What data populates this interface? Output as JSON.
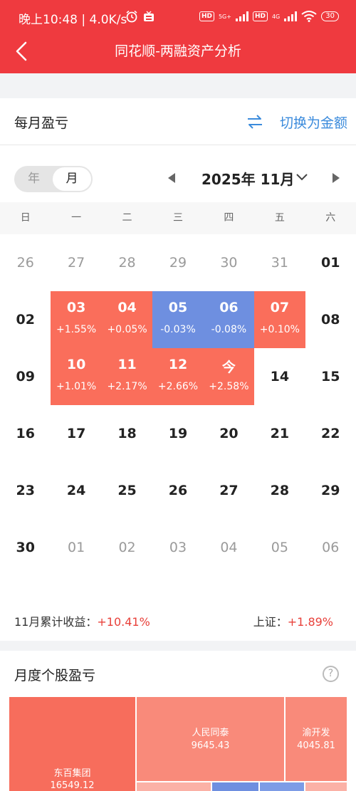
{
  "status": {
    "time": "晚上10:48 | 4.0K/s",
    "hd": "HD",
    "net1": "5G+",
    "net2": "4G",
    "battery": "30"
  },
  "header": {
    "title": "同花顺-两融资产分析"
  },
  "monthly": {
    "title": "每月盈亏",
    "switch_label": "切换为金额"
  },
  "toggle": {
    "year": "年",
    "month": "月"
  },
  "calendar": {
    "month_label": "2025年 11月",
    "weekdays": [
      "日",
      "一",
      "二",
      "三",
      "四",
      "五",
      "六"
    ],
    "weeks": [
      [
        {
          "d": "26",
          "muted": true
        },
        {
          "d": "27",
          "muted": true
        },
        {
          "d": "28",
          "muted": true
        },
        {
          "d": "29",
          "muted": true
        },
        {
          "d": "30",
          "muted": true
        },
        {
          "d": "31",
          "muted": true
        },
        {
          "d": "01"
        }
      ],
      [
        {
          "d": "02"
        },
        {
          "d": "03",
          "pct": "+1.55%",
          "dir": "up"
        },
        {
          "d": "04",
          "pct": "+0.05%",
          "dir": "up"
        },
        {
          "d": "05",
          "pct": "-0.03%",
          "dir": "down"
        },
        {
          "d": "06",
          "pct": "-0.08%",
          "dir": "down"
        },
        {
          "d": "07",
          "pct": "+0.10%",
          "dir": "up"
        },
        {
          "d": "08"
        }
      ],
      [
        {
          "d": "09"
        },
        {
          "d": "10",
          "pct": "+1.01%",
          "dir": "up"
        },
        {
          "d": "11",
          "pct": "+2.17%",
          "dir": "up"
        },
        {
          "d": "12",
          "pct": "+2.66%",
          "dir": "up"
        },
        {
          "d": "今",
          "pct": "+2.58%",
          "dir": "up"
        },
        {
          "d": "14"
        },
        {
          "d": "15"
        }
      ],
      [
        {
          "d": "16"
        },
        {
          "d": "17"
        },
        {
          "d": "18"
        },
        {
          "d": "19"
        },
        {
          "d": "20"
        },
        {
          "d": "21"
        },
        {
          "d": "22"
        }
      ],
      [
        {
          "d": "23"
        },
        {
          "d": "24"
        },
        {
          "d": "25"
        },
        {
          "d": "26"
        },
        {
          "d": "27"
        },
        {
          "d": "28"
        },
        {
          "d": "29"
        }
      ],
      [
        {
          "d": "30"
        },
        {
          "d": "01",
          "muted": true
        },
        {
          "d": "02",
          "muted": true
        },
        {
          "d": "03",
          "muted": true
        },
        {
          "d": "04",
          "muted": true
        },
        {
          "d": "05",
          "muted": true
        },
        {
          "d": "06",
          "muted": true
        }
      ]
    ]
  },
  "summary": {
    "month_label": "11月累计收益：",
    "month_value": "+10.41%",
    "index_label": "上证：",
    "index_value": "+1.89%"
  },
  "stocks": {
    "title": "月度个股盈亏",
    "help": "?",
    "items": [
      {
        "name": "东百集团",
        "value": "16549.12"
      },
      {
        "name": "人民同泰",
        "value": "9645.43"
      },
      {
        "name": "渝开发",
        "value": "4045.81"
      }
    ]
  },
  "colors": {
    "header": "#ef3a3f",
    "up": "#fa6e5b",
    "down": "#6e8fe0",
    "link": "#3b8bdc"
  }
}
